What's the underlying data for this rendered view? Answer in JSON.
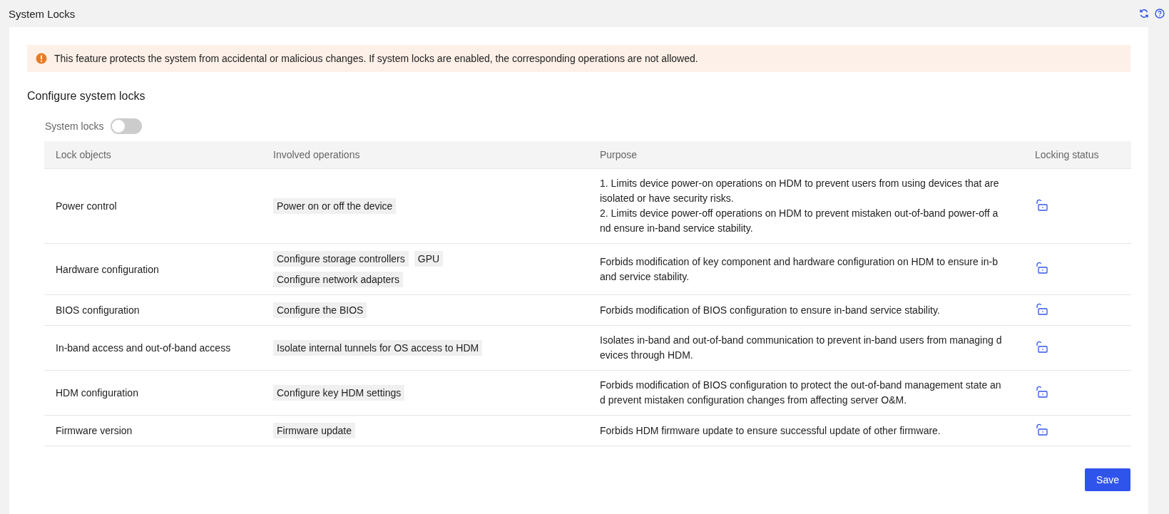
{
  "page": {
    "title": "System Locks"
  },
  "alert": {
    "text": "This feature protects the system from accidental or malicious changes. If system locks are enabled, the corresponding operations are not allowed."
  },
  "section": {
    "title": "Configure system locks"
  },
  "system_locks": {
    "label": "System locks",
    "on": false
  },
  "table": {
    "columns": [
      "Lock objects",
      "Involved operations",
      "Purpose",
      "Locking status"
    ],
    "rows": [
      {
        "object": "Power control",
        "operations": [
          "Power on or off the device"
        ],
        "purpose": [
          "1. Limits device power-on operations on HDM to prevent users from using devices that are isolated or have security risks.",
          "2. Limits device power-off operations on HDM to prevent mistaken out-of-band power-off and ensure in-band service stability."
        ],
        "locked": false
      },
      {
        "object": "Hardware configuration",
        "operations": [
          "Configure storage controllers",
          "GPU",
          "Configure network adapters"
        ],
        "purpose": [
          "Forbids modification of key component and hardware configuration on HDM to ensure in-band service stability."
        ],
        "locked": false
      },
      {
        "object": "BIOS configuration",
        "operations": [
          "Configure the BIOS"
        ],
        "purpose": [
          "Forbids modification of BIOS configuration to ensure in-band service stability."
        ],
        "locked": false
      },
      {
        "object": "In-band access and out-of-band access",
        "operations": [
          "Isolate internal tunnels for OS access to HDM"
        ],
        "purpose": [
          "Isolates in-band and out-of-band communication to prevent in-band users from managing devices through HDM."
        ],
        "locked": false
      },
      {
        "object": "HDM configuration",
        "operations": [
          "Configure key HDM settings"
        ],
        "purpose": [
          "Forbids modification of BIOS configuration to protect the out-of-band management state and prevent mistaken configuration changes from affecting server O&M."
        ],
        "locked": false
      },
      {
        "object": "Firmware version",
        "operations": [
          "Firmware update"
        ],
        "purpose": [
          "Forbids HDM firmware update to ensure successful update of other firmware."
        ],
        "locked": false
      }
    ]
  },
  "save_button": {
    "label": "Save"
  }
}
